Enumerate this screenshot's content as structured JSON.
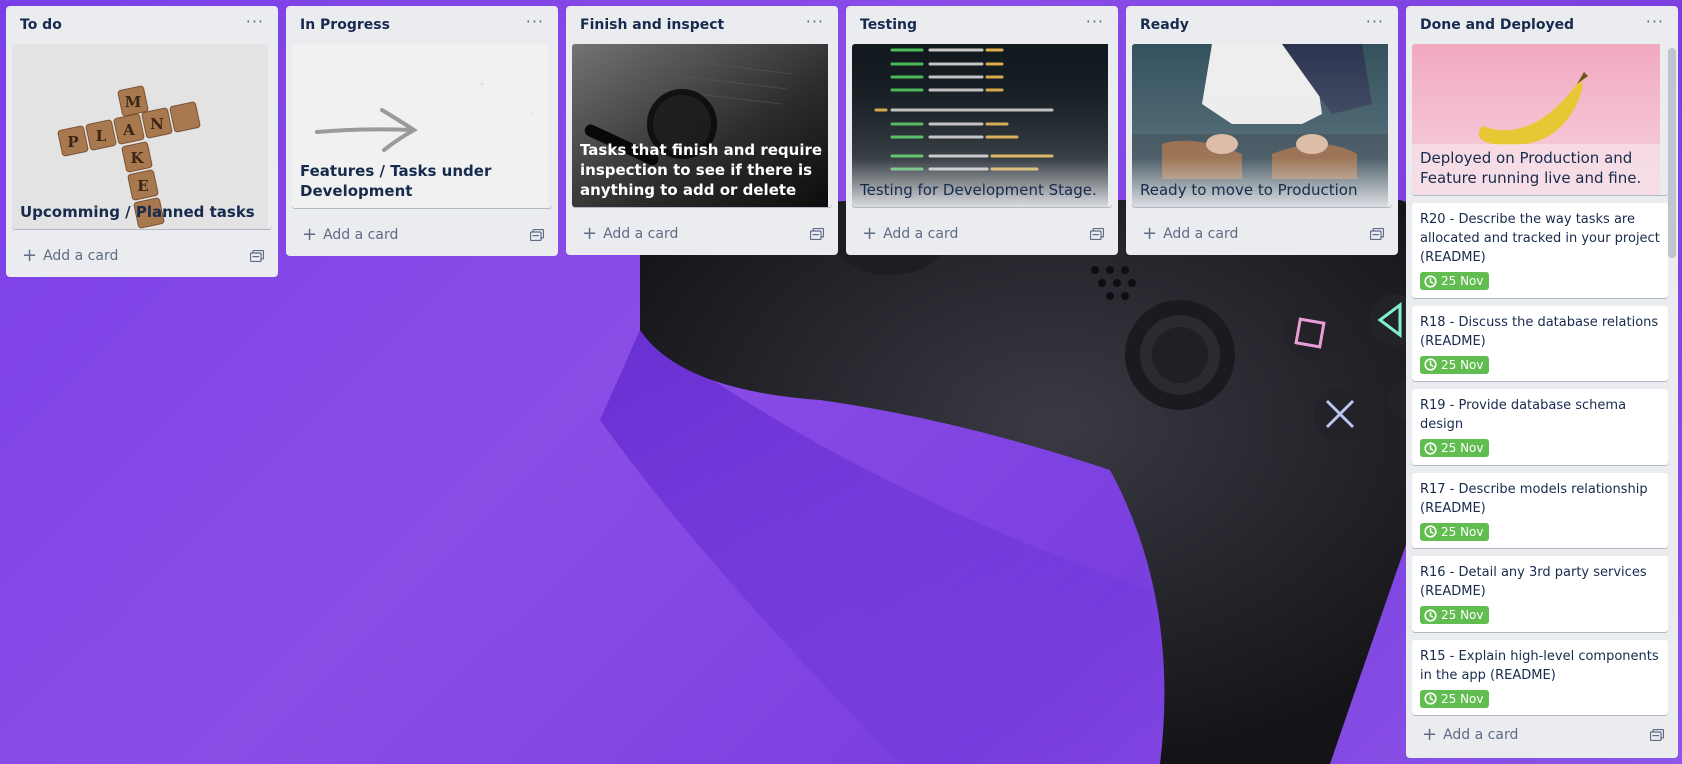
{
  "lists": [
    {
      "title": "To do",
      "cover": {
        "title": "Upcomming / Planned tasks",
        "art": "scrabble-plan-make-image"
      },
      "add_label": "Add a card"
    },
    {
      "title": "In Progress",
      "cover": {
        "title": "Features / Tasks under Development",
        "art": "arrow-on-paper-image"
      },
      "add_label": "Add a card"
    },
    {
      "title": "Finish and inspect",
      "cover": {
        "title": "Tasks that finish and require inspection to see if there is anything to add or delete",
        "art": "magnifier-laptop-image"
      },
      "add_label": "Add a card"
    },
    {
      "title": "Testing",
      "cover": {
        "title": "Testing for Development Stage.",
        "art": "code-screen-image"
      },
      "add_label": "Add a card"
    },
    {
      "title": "Ready",
      "cover": {
        "title": "Ready to move to Production",
        "art": "tying-shoes-image"
      },
      "add_label": "Add a card"
    },
    {
      "title": "Done and Deployed",
      "cover": {
        "title": "Deployed on Production and Feature running live and fine.",
        "art": "banana-pink-image"
      },
      "cards": [
        {
          "title": "R20 - Describe the way tasks are allocated and tracked in your project (README)",
          "due": "25 Nov"
        },
        {
          "title": "R18 - Discuss the database relations (README)",
          "due": "25 Nov"
        },
        {
          "title": "R19 - Provide database schema design",
          "due": "25 Nov"
        },
        {
          "title": "R17 - Describe models relationship (README)",
          "due": "25 Nov"
        },
        {
          "title": "R16 - Detail any 3rd party services (README)",
          "due": "25 Nov"
        },
        {
          "title": "R15 - Explain high-level components in the app (README)",
          "due": "25 Nov"
        }
      ],
      "add_label": "Add a card"
    }
  ],
  "icons": {
    "menu": "more-horizontal-icon",
    "add": "plus-icon",
    "template": "card-template-icon",
    "due": "clock-icon"
  },
  "colors": {
    "list_bg": "#ebecf0",
    "due_badge": "#61bd4f",
    "board_bg": "#7a3fe8"
  }
}
